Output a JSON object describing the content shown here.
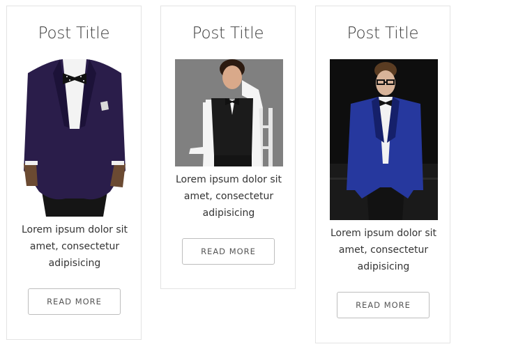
{
  "posts": [
    {
      "title": "Post Title",
      "image_alt": "man in purple velvet tuxedo jacket with bow tie",
      "excerpt": "Lorem ipsum dolor sit amet, consectetur adipisicing",
      "button_label": "READ MORE"
    },
    {
      "title": "Post Title",
      "image_alt": "boy in black vest and bow tie",
      "excerpt": "Lorem ipsum dolor sit amet, consectetur adipisicing",
      "button_label": "READ MORE"
    },
    {
      "title": "Post Title",
      "image_alt": "model in blue patterned jacket on runway",
      "excerpt": "Lorem ipsum dolor sit amet, consectetur adipisicing",
      "button_label": "READ MORE"
    }
  ],
  "colors": {
    "card_border": "#e3e3e3",
    "button_border": "#bdbdbd",
    "text": "#333333",
    "title": "#3a3a3a"
  }
}
